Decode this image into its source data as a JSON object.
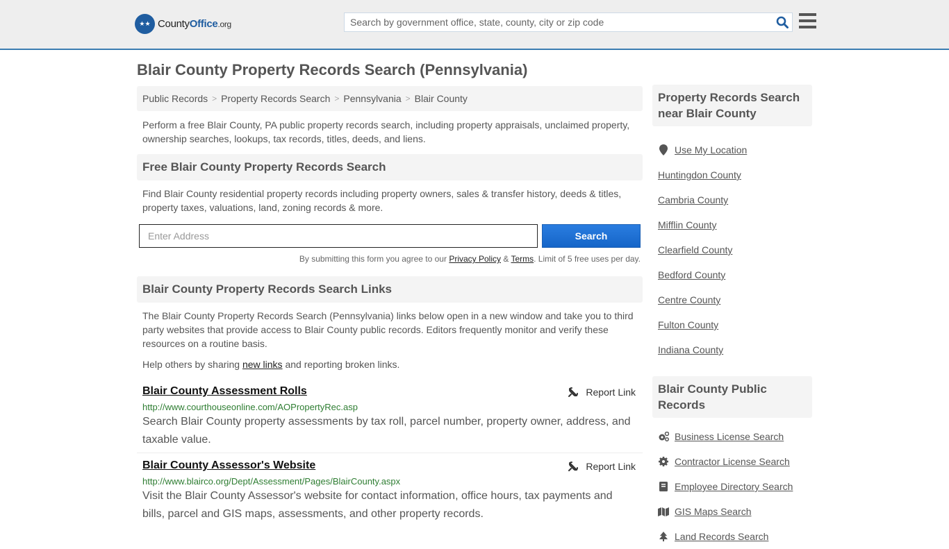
{
  "header": {
    "logo": {
      "part1": "County",
      "part2": "Office",
      "part3": ".org"
    },
    "search_placeholder": "Search by government office, state, county, city or zip code"
  },
  "page_title": "Blair County Property Records Search (Pennsylvania)",
  "breadcrumb": [
    "Public Records",
    "Property Records Search",
    "Pennsylvania",
    "Blair County"
  ],
  "intro": "Perform a free Blair County, PA public property records search, including property appraisals, unclaimed property, ownership searches, lookups, tax records, titles, deeds, and liens.",
  "free_search": {
    "heading": "Free Blair County Property Records Search",
    "text": "Find Blair County residential property records including property owners, sales & transfer history, deeds & titles, property taxes, valuations, land, zoning records & more.",
    "input_placeholder": "Enter Address",
    "button_label": "Search",
    "disclaimer_pre": "By submitting this form you agree to our ",
    "privacy_label": "Privacy Policy",
    "amp": " & ",
    "terms_label": "Terms",
    "disclaimer_post": ". Limit of 5 free uses per day."
  },
  "links_section": {
    "heading": "Blair County Property Records Search Links",
    "text": "The Blair County Property Records Search (Pennsylvania) links below open in a new window and take you to third party websites that provide access to Blair County public records. Editors frequently monitor and verify these resources on a routine basis.",
    "help_pre": "Help others by sharing ",
    "help_link": "new links",
    "help_post": " and reporting broken links.",
    "report_label": "Report Link",
    "items": [
      {
        "title": "Blair County Assessment Rolls",
        "url": "http://www.courthouseonline.com/AOPropertyRec.asp",
        "desc": "Search Blair County property assessments by tax roll, parcel number, property owner, address, and taxable value."
      },
      {
        "title": "Blair County Assessor's Website",
        "url": "http://www.blairco.org/Dept/Assessment/Pages/BlairCounty.aspx",
        "desc": "Visit the Blair County Assessor's website for contact information, office hours, tax payments and bills, parcel and GIS maps, assessments, and other property records."
      }
    ]
  },
  "sidebar": {
    "near_heading": "Property Records Search near Blair County",
    "use_location": "Use My Location",
    "near_items": [
      "Huntingdon County",
      "Cambria County",
      "Mifflin County",
      "Clearfield County",
      "Bedford County",
      "Centre County",
      "Fulton County",
      "Indiana County"
    ],
    "public_heading": "Blair County Public Records",
    "public_items": [
      {
        "label": "Business License Search",
        "icon": "gears-icon"
      },
      {
        "label": "Contractor License Search",
        "icon": "gear-icon"
      },
      {
        "label": "Employee Directory Search",
        "icon": "book-icon"
      },
      {
        "label": "GIS Maps Search",
        "icon": "map-icon"
      },
      {
        "label": "Land Records Search",
        "icon": "tree-icon"
      }
    ]
  }
}
